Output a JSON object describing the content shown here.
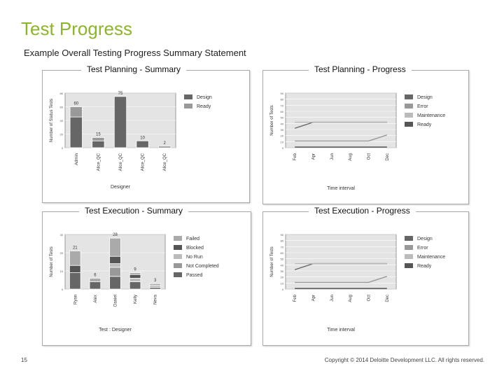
{
  "slide": {
    "title": "Test Progress",
    "subtitle": "Example Overall Testing Progress Summary Statement",
    "page_number": "15",
    "copyright": "Copyright © 2014 Deloitte Development LLC. All rights reserved."
  },
  "colors": {
    "title": "#8db52a"
  },
  "chart_data": [
    {
      "type": "bar",
      "stacked": true,
      "title": "Test Planning - Summary",
      "xlabel": "Designer",
      "ylabel": "Number of Status Tests",
      "ylim": [
        0,
        80
      ],
      "yticks": [
        0,
        20,
        40,
        60,
        80
      ],
      "categories": [
        "Admin",
        "Alice_QC",
        "Alice_QC",
        "Alice_QC",
        "Alice_QC"
      ],
      "series": [
        {
          "name": "Design",
          "values": [
            45,
            10,
            75,
            10,
            2
          ]
        },
        {
          "name": "Ready",
          "values": [
            15,
            5,
            0,
            0,
            0
          ]
        }
      ],
      "totals": [
        60,
        15,
        75,
        10,
        2
      ],
      "legend": "right",
      "grid": true
    },
    {
      "type": "line",
      "title": "Test Planning - Progress",
      "xlabel": "Time interval",
      "ylabel": "Number of Tests",
      "ylim": [
        0,
        90
      ],
      "yticks": [
        0,
        10,
        20,
        30,
        40,
        50,
        60,
        70,
        80,
        90
      ],
      "categories": [
        "Feb",
        "Apr",
        "Jun",
        "Aug",
        "Oct",
        "Dec"
      ],
      "series": [
        {
          "name": "Design",
          "values": [
            32,
            42,
            42,
            42,
            42,
            42
          ]
        },
        {
          "name": "Error",
          "values": [
            11,
            11,
            11,
            11,
            11,
            21
          ]
        },
        {
          "name": "Maintenance",
          "values": [
            42,
            42,
            42,
            42,
            42,
            42
          ]
        },
        {
          "name": "Ready",
          "values": [
            1,
            1,
            1,
            1,
            1,
            1
          ]
        }
      ],
      "legend": "right",
      "grid": true
    },
    {
      "type": "bar",
      "stacked": true,
      "title": "Test Execution - Summary",
      "xlabel": "Test : Designer",
      "ylabel": "Number of Tests",
      "ylim": [
        0,
        30
      ],
      "yticks": [
        0,
        10,
        20,
        30
      ],
      "categories": [
        "Ryan",
        "Alex",
        "Daniel",
        "Kelly",
        "Neva"
      ],
      "series": [
        {
          "name": "Passed",
          "values": [
            9,
            4,
            7,
            4,
            1
          ]
        },
        {
          "name": "Not Completed",
          "values": [
            0,
            0,
            5,
            0,
            0
          ]
        },
        {
          "name": "No Run",
          "values": [
            0,
            0,
            2,
            2,
            1
          ]
        },
        {
          "name": "Blocked",
          "values": [
            4,
            0,
            4,
            2,
            0
          ]
        },
        {
          "name": "Failed",
          "values": [
            8,
            2,
            10,
            1,
            1
          ]
        }
      ],
      "totals": [
        21,
        6,
        28,
        9,
        3
      ],
      "legend": "right",
      "grid": true
    },
    {
      "type": "line",
      "title": "Test Execution - Progress",
      "xlabel": "Time interval",
      "ylabel": "Number of Tests",
      "ylim": [
        0,
        90
      ],
      "yticks": [
        0,
        10,
        20,
        30,
        40,
        50,
        60,
        70,
        80,
        90
      ],
      "categories": [
        "Feb",
        "Apr",
        "Jun",
        "Aug",
        "Oct",
        "Dec"
      ],
      "series": [
        {
          "name": "Design",
          "values": [
            32,
            42,
            42,
            42,
            42,
            42
          ]
        },
        {
          "name": "Error",
          "values": [
            11,
            11,
            11,
            11,
            11,
            21
          ]
        },
        {
          "name": "Maintenance",
          "values": [
            42,
            42,
            42,
            42,
            42,
            42
          ]
        },
        {
          "name": "Ready",
          "values": [
            1,
            1,
            1,
            1,
            1,
            1
          ]
        }
      ],
      "legend": "right",
      "grid": true
    }
  ]
}
